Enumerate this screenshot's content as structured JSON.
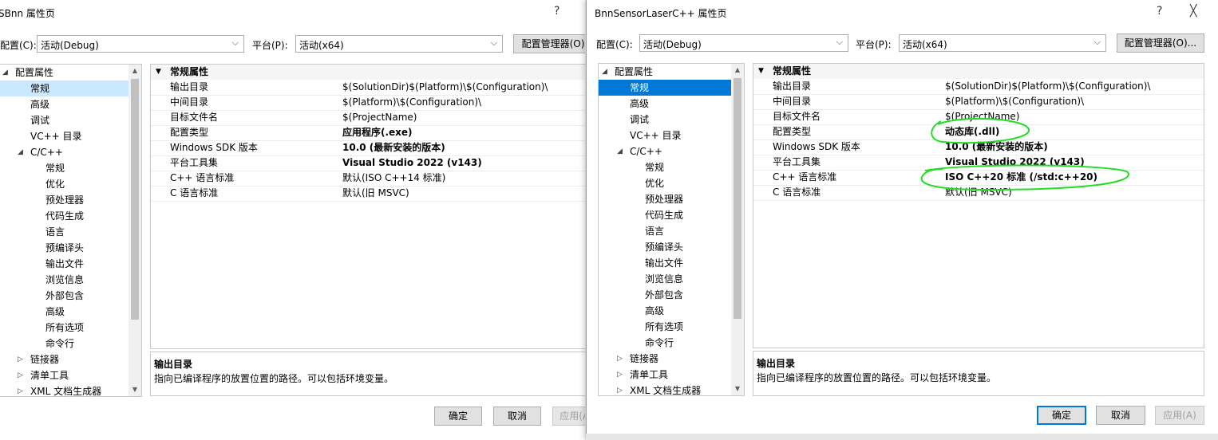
{
  "left": {
    "title": "SBnn 属性页",
    "help_label": "?",
    "config_label": "配置(C):",
    "config_value": "活动(Debug)",
    "platform_label": "平台(P):",
    "platform_value": "活动(x64)",
    "config_manager_label": "配置管理器(O)",
    "tree": [
      {
        "label": "配置属性",
        "twisty": "◢"
      },
      {
        "label": "常规"
      },
      {
        "label": "高级"
      },
      {
        "label": "调试"
      },
      {
        "label": "VC++ 目录"
      },
      {
        "label": "C/C++",
        "twisty": "◢"
      },
      {
        "label": "常规"
      },
      {
        "label": "优化"
      },
      {
        "label": "预处理器"
      },
      {
        "label": "代码生成"
      },
      {
        "label": "语言"
      },
      {
        "label": "预编译头"
      },
      {
        "label": "输出文件"
      },
      {
        "label": "浏览信息"
      },
      {
        "label": "外部包含"
      },
      {
        "label": "高级"
      },
      {
        "label": "所有选项"
      },
      {
        "label": "命令行"
      },
      {
        "label": "链接器",
        "twisty": "▷"
      },
      {
        "label": "清单工具",
        "twisty": "▷"
      },
      {
        "label": "XML 文档生成器",
        "twisty": "▷"
      }
    ],
    "group_header": "常规属性",
    "properties": [
      {
        "name": "输出目录",
        "value": "$(SolutionDir)$(Platform)\\$(Configuration)\\",
        "bold": false
      },
      {
        "name": "中间目录",
        "value": "$(Platform)\\$(Configuration)\\",
        "bold": false
      },
      {
        "name": "目标文件名",
        "value": "$(ProjectName)",
        "bold": false
      },
      {
        "name": "配置类型",
        "value": "应用程序(.exe)",
        "bold": true
      },
      {
        "name": "Windows SDK 版本",
        "value": "10.0 (最新安装的版本)",
        "bold": true
      },
      {
        "name": "平台工具集",
        "value": "Visual Studio 2022 (v143)",
        "bold": true
      },
      {
        "name": "C++ 语言标准",
        "value": "默认(ISO C++14 标准)",
        "bold": false
      },
      {
        "name": "C 语言标准",
        "value": "默认(旧 MSVC)",
        "bold": false
      }
    ],
    "desc_title": "输出目录",
    "desc_text": "指向已编译程序的放置位置的路径。可以包括环境变量。",
    "ok_label": "确定",
    "cancel_label": "取消",
    "apply_label": "应用(A)"
  },
  "right": {
    "title": "BnnSensorLaserC++ 属性页",
    "help_label": "?",
    "close_label": "╳",
    "config_label": "配置(C):",
    "config_value": "活动(Debug)",
    "platform_label": "平台(P):",
    "platform_value": "活动(x64)",
    "config_manager_label": "配置管理器(O)...",
    "tree": [
      {
        "label": "配置属性",
        "twisty": "◢"
      },
      {
        "label": "常规"
      },
      {
        "label": "高级"
      },
      {
        "label": "调试"
      },
      {
        "label": "VC++ 目录"
      },
      {
        "label": "C/C++",
        "twisty": "◢"
      },
      {
        "label": "常规"
      },
      {
        "label": "优化"
      },
      {
        "label": "预处理器"
      },
      {
        "label": "代码生成"
      },
      {
        "label": "语言"
      },
      {
        "label": "预编译头"
      },
      {
        "label": "输出文件"
      },
      {
        "label": "浏览信息"
      },
      {
        "label": "外部包含"
      },
      {
        "label": "高级"
      },
      {
        "label": "所有选项"
      },
      {
        "label": "命令行"
      },
      {
        "label": "链接器",
        "twisty": "▷"
      },
      {
        "label": "清单工具",
        "twisty": "▷"
      },
      {
        "label": "XML 文档生成器",
        "twisty": "▷"
      }
    ],
    "group_header": "常规属性",
    "properties": [
      {
        "name": "输出目录",
        "value": "$(SolutionDir)$(Platform)\\$(Configuration)\\",
        "bold": false
      },
      {
        "name": "中间目录",
        "value": "$(Platform)\\$(Configuration)\\",
        "bold": false
      },
      {
        "name": "目标文件名",
        "value": "$(ProjectName)",
        "bold": false
      },
      {
        "name": "配置类型",
        "value": "动态库(.dll)",
        "bold": true
      },
      {
        "name": "Windows SDK 版本",
        "value": "10.0 (最新安装的版本)",
        "bold": true
      },
      {
        "name": "平台工具集",
        "value": "Visual Studio 2022 (v143)",
        "bold": true
      },
      {
        "name": "C++ 语言标准",
        "value": "ISO C++20 标准 (/std:c++20)",
        "bold": true
      },
      {
        "name": "C 语言标准",
        "value": "默认(旧 MSVC)",
        "bold": false
      }
    ],
    "desc_title": "输出目录",
    "desc_text": "指向已编译程序的放置位置的路径。可以包括环境变量。",
    "ok_label": "确定",
    "cancel_label": "取消",
    "apply_label": "应用(A)"
  },
  "colors": {
    "selection": "#0078d7",
    "annotation": "#22dd22"
  }
}
